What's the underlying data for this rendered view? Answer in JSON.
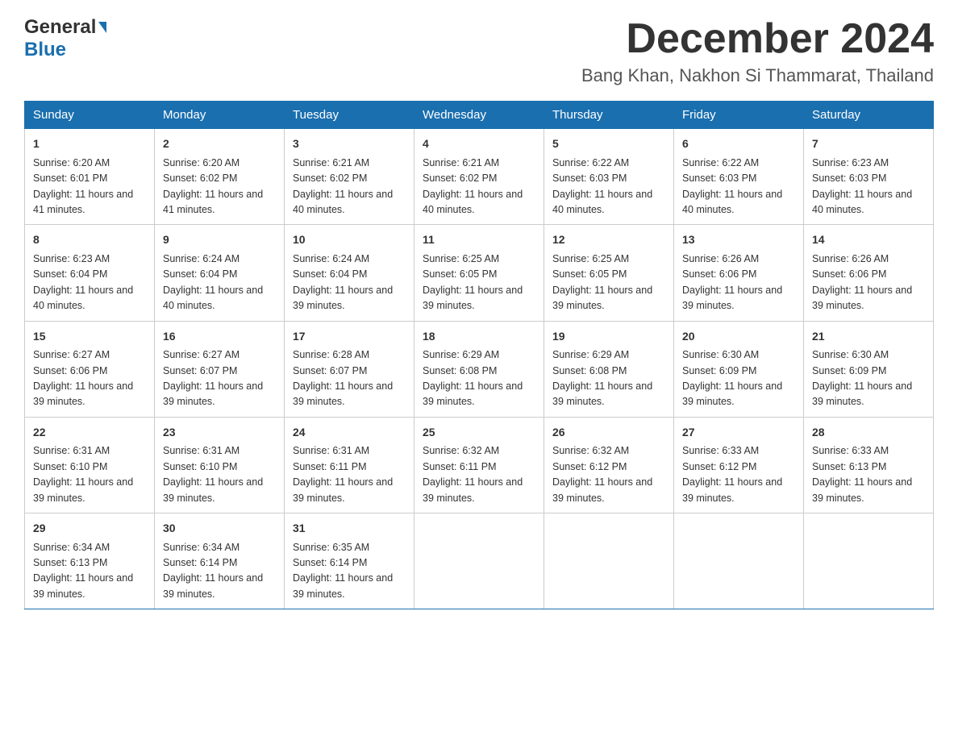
{
  "header": {
    "logo_general": "General",
    "logo_blue": "Blue",
    "month_title": "December 2024",
    "location": "Bang Khan, Nakhon Si Thammarat, Thailand"
  },
  "weekdays": [
    "Sunday",
    "Monday",
    "Tuesday",
    "Wednesday",
    "Thursday",
    "Friday",
    "Saturday"
  ],
  "weeks": [
    [
      {
        "day": "1",
        "sunrise": "6:20 AM",
        "sunset": "6:01 PM",
        "daylight": "11 hours and 41 minutes."
      },
      {
        "day": "2",
        "sunrise": "6:20 AM",
        "sunset": "6:02 PM",
        "daylight": "11 hours and 41 minutes."
      },
      {
        "day": "3",
        "sunrise": "6:21 AM",
        "sunset": "6:02 PM",
        "daylight": "11 hours and 40 minutes."
      },
      {
        "day": "4",
        "sunrise": "6:21 AM",
        "sunset": "6:02 PM",
        "daylight": "11 hours and 40 minutes."
      },
      {
        "day": "5",
        "sunrise": "6:22 AM",
        "sunset": "6:03 PM",
        "daylight": "11 hours and 40 minutes."
      },
      {
        "day": "6",
        "sunrise": "6:22 AM",
        "sunset": "6:03 PM",
        "daylight": "11 hours and 40 minutes."
      },
      {
        "day": "7",
        "sunrise": "6:23 AM",
        "sunset": "6:03 PM",
        "daylight": "11 hours and 40 minutes."
      }
    ],
    [
      {
        "day": "8",
        "sunrise": "6:23 AM",
        "sunset": "6:04 PM",
        "daylight": "11 hours and 40 minutes."
      },
      {
        "day": "9",
        "sunrise": "6:24 AM",
        "sunset": "6:04 PM",
        "daylight": "11 hours and 40 minutes."
      },
      {
        "day": "10",
        "sunrise": "6:24 AM",
        "sunset": "6:04 PM",
        "daylight": "11 hours and 39 minutes."
      },
      {
        "day": "11",
        "sunrise": "6:25 AM",
        "sunset": "6:05 PM",
        "daylight": "11 hours and 39 minutes."
      },
      {
        "day": "12",
        "sunrise": "6:25 AM",
        "sunset": "6:05 PM",
        "daylight": "11 hours and 39 minutes."
      },
      {
        "day": "13",
        "sunrise": "6:26 AM",
        "sunset": "6:06 PM",
        "daylight": "11 hours and 39 minutes."
      },
      {
        "day": "14",
        "sunrise": "6:26 AM",
        "sunset": "6:06 PM",
        "daylight": "11 hours and 39 minutes."
      }
    ],
    [
      {
        "day": "15",
        "sunrise": "6:27 AM",
        "sunset": "6:06 PM",
        "daylight": "11 hours and 39 minutes."
      },
      {
        "day": "16",
        "sunrise": "6:27 AM",
        "sunset": "6:07 PM",
        "daylight": "11 hours and 39 minutes."
      },
      {
        "day": "17",
        "sunrise": "6:28 AM",
        "sunset": "6:07 PM",
        "daylight": "11 hours and 39 minutes."
      },
      {
        "day": "18",
        "sunrise": "6:29 AM",
        "sunset": "6:08 PM",
        "daylight": "11 hours and 39 minutes."
      },
      {
        "day": "19",
        "sunrise": "6:29 AM",
        "sunset": "6:08 PM",
        "daylight": "11 hours and 39 minutes."
      },
      {
        "day": "20",
        "sunrise": "6:30 AM",
        "sunset": "6:09 PM",
        "daylight": "11 hours and 39 minutes."
      },
      {
        "day": "21",
        "sunrise": "6:30 AM",
        "sunset": "6:09 PM",
        "daylight": "11 hours and 39 minutes."
      }
    ],
    [
      {
        "day": "22",
        "sunrise": "6:31 AM",
        "sunset": "6:10 PM",
        "daylight": "11 hours and 39 minutes."
      },
      {
        "day": "23",
        "sunrise": "6:31 AM",
        "sunset": "6:10 PM",
        "daylight": "11 hours and 39 minutes."
      },
      {
        "day": "24",
        "sunrise": "6:31 AM",
        "sunset": "6:11 PM",
        "daylight": "11 hours and 39 minutes."
      },
      {
        "day": "25",
        "sunrise": "6:32 AM",
        "sunset": "6:11 PM",
        "daylight": "11 hours and 39 minutes."
      },
      {
        "day": "26",
        "sunrise": "6:32 AM",
        "sunset": "6:12 PM",
        "daylight": "11 hours and 39 minutes."
      },
      {
        "day": "27",
        "sunrise": "6:33 AM",
        "sunset": "6:12 PM",
        "daylight": "11 hours and 39 minutes."
      },
      {
        "day": "28",
        "sunrise": "6:33 AM",
        "sunset": "6:13 PM",
        "daylight": "11 hours and 39 minutes."
      }
    ],
    [
      {
        "day": "29",
        "sunrise": "6:34 AM",
        "sunset": "6:13 PM",
        "daylight": "11 hours and 39 minutes."
      },
      {
        "day": "30",
        "sunrise": "6:34 AM",
        "sunset": "6:14 PM",
        "daylight": "11 hours and 39 minutes."
      },
      {
        "day": "31",
        "sunrise": "6:35 AM",
        "sunset": "6:14 PM",
        "daylight": "11 hours and 39 minutes."
      },
      null,
      null,
      null,
      null
    ]
  ],
  "labels": {
    "sunrise_prefix": "Sunrise: ",
    "sunset_prefix": "Sunset: ",
    "daylight_prefix": "Daylight: "
  }
}
